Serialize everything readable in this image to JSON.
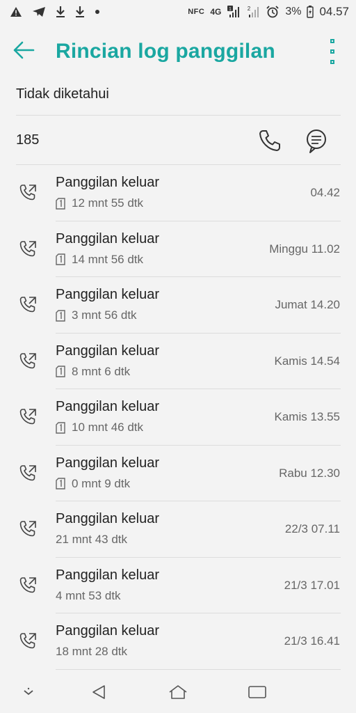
{
  "status": {
    "nfc": "NFC",
    "network": "4G",
    "sim1_badge": "1",
    "sim2_badge": "2",
    "battery": "3%",
    "time": "04.57"
  },
  "header": {
    "title": "Rincian log panggilan"
  },
  "contact": {
    "name": "Tidak diketahui",
    "number": "185"
  },
  "calls": [
    {
      "type": "Panggilan keluar",
      "duration": "12 mnt 55 dtk",
      "time": "04.42",
      "sim": true
    },
    {
      "type": "Panggilan keluar",
      "duration": "14 mnt 56 dtk",
      "time": "Minggu 11.02",
      "sim": true
    },
    {
      "type": "Panggilan keluar",
      "duration": "3 mnt 56 dtk",
      "time": "Jumat 14.20",
      "sim": true
    },
    {
      "type": "Panggilan keluar",
      "duration": "8 mnt 6 dtk",
      "time": "Kamis 14.54",
      "sim": true
    },
    {
      "type": "Panggilan keluar",
      "duration": "10 mnt 46 dtk",
      "time": "Kamis 13.55",
      "sim": true
    },
    {
      "type": "Panggilan keluar",
      "duration": "0 mnt 9 dtk",
      "time": "Rabu 12.30",
      "sim": true
    },
    {
      "type": "Panggilan keluar",
      "duration": "21 mnt 43 dtk",
      "time": "22/3 07.11",
      "sim": false
    },
    {
      "type": "Panggilan keluar",
      "duration": "4 mnt 53 dtk",
      "time": "21/3 17.01",
      "sim": false
    },
    {
      "type": "Panggilan keluar",
      "duration": "18 mnt 28 dtk",
      "time": "21/3 16.41",
      "sim": false
    }
  ],
  "colors": {
    "accent": "#1aa7a1",
    "text": "#222222",
    "secondary": "#666666",
    "background": "#f3f3f3"
  },
  "icons": {
    "back": "arrow-left-icon",
    "menu": "more-vert-icon",
    "call": "phone-icon",
    "message": "message-icon",
    "outgoing": "outgoing-call-icon",
    "sim": "sim1-icon"
  }
}
